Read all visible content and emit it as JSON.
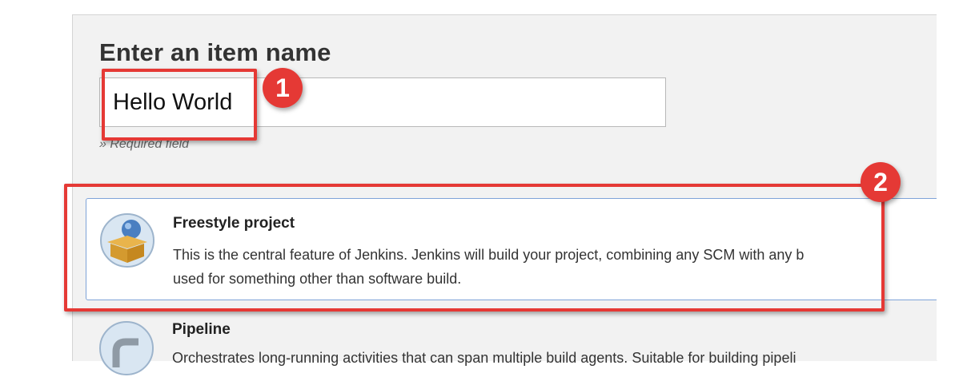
{
  "form": {
    "title": "Enter an item name",
    "item_name_value": "Hello World",
    "required_text": "» Required field"
  },
  "item_types": [
    {
      "label": "Freestyle project",
      "description_line1": "This is the central feature of Jenkins. Jenkins will build your project, combining any SCM with any b",
      "description_line2": "used for something other than software build.",
      "icon": "freestyle-box-icon"
    },
    {
      "label": "Pipeline",
      "description_line1": "Orchestrates long-running activities that can span multiple build agents. Suitable for building pipeli",
      "icon": "pipeline-icon"
    }
  ],
  "annotations": {
    "badge_1": "1",
    "badge_2": "2",
    "color": "#e53935"
  },
  "colors": {
    "panel_bg": "#f2f2f2",
    "selected_border": "#7fa3d8"
  }
}
